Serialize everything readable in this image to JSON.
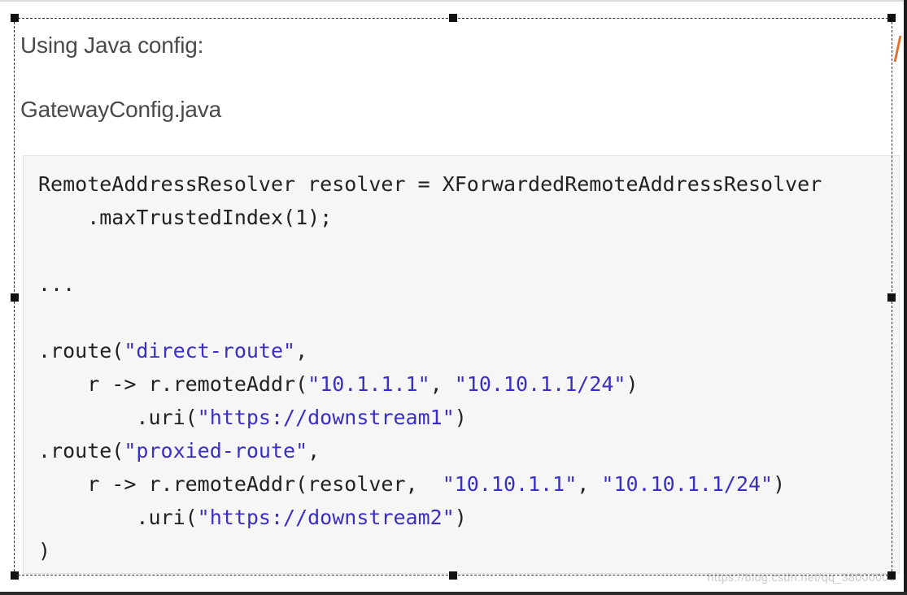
{
  "headings": {
    "intro": "Using Java config:",
    "file": "GatewayConfig.java"
  },
  "code": {
    "l1": "RemoteAddressResolver resolver = XForwardedRemoteAddressResolver",
    "l2": "    .maxTrustedIndex(1);",
    "l3": "",
    "l4": "...",
    "l5": "",
    "l6_pre": ".route(",
    "l6_str": "\"direct-route\"",
    "l6_post": ",",
    "l7_pre": "    r -> r.remoteAddr(",
    "l7_s1": "\"10.1.1.1\"",
    "l7_mid": ", ",
    "l7_s2": "\"10.10.1.1/24\"",
    "l7_post": ")",
    "l8_pre": "        .uri(",
    "l8_str": "\"https://downstream1\"",
    "l8_post": ")",
    "l9_pre": ".route(",
    "l9_str": "\"proxied-route\"",
    "l9_post": ",",
    "l10_pre": "    r -> r.remoteAddr(resolver,  ",
    "l10_s1": "\"10.10.1.1\"",
    "l10_mid": ", ",
    "l10_s2": "\"10.10.1.1/24\"",
    "l10_post": ")",
    "l11_pre": "        .uri(",
    "l11_str": "\"https://downstream2\"",
    "l11_post": ")",
    "l12": ")"
  },
  "watermark": "https://blog.csdn.net/qq_38000000",
  "colors": {
    "string": "#3a2fc4",
    "text": "#222222",
    "code_bg": "#f6f6f6",
    "accent_mark": "#e2722f"
  }
}
